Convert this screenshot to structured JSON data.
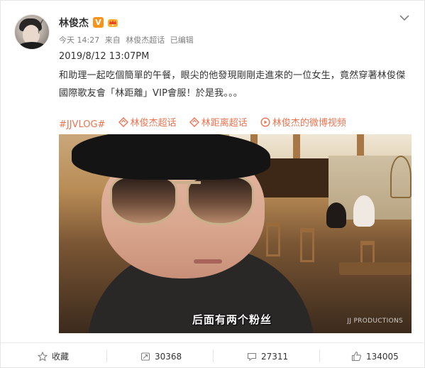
{
  "user": {
    "name": "林俊杰",
    "verify_badge": "V"
  },
  "meta": {
    "time": "今天 14:27",
    "source_prefix": "来自",
    "source": "林俊杰超话",
    "edited": "已编辑"
  },
  "post": {
    "date": "2019/8/12 13:07PM",
    "text": "和助理一起吃個簡單的午餐，眼尖的他發現剛剛走進來的一位女生，竟然穿著林俊傑國際歌友會「林距離」VIP會服！於是我。。。"
  },
  "tags": [
    {
      "label": "#JJVLOG#",
      "icon": "none"
    },
    {
      "label": "林俊杰超话",
      "icon": "supertopic-icon"
    },
    {
      "label": "林距离超话",
      "icon": "supertopic-icon"
    },
    {
      "label": "林俊杰的微博视频",
      "icon": "video-icon"
    }
  ],
  "video": {
    "subtitle": "后面有两个粉丝",
    "watermark": "JJ PRODUCTIONS"
  },
  "toolbar": {
    "favorite_label": "收藏",
    "repost_count": "30368",
    "comment_count": "27311",
    "like_count": "134005"
  },
  "colors": {
    "accent_link": "#eb7350",
    "verify_orange": "#f7941d"
  }
}
